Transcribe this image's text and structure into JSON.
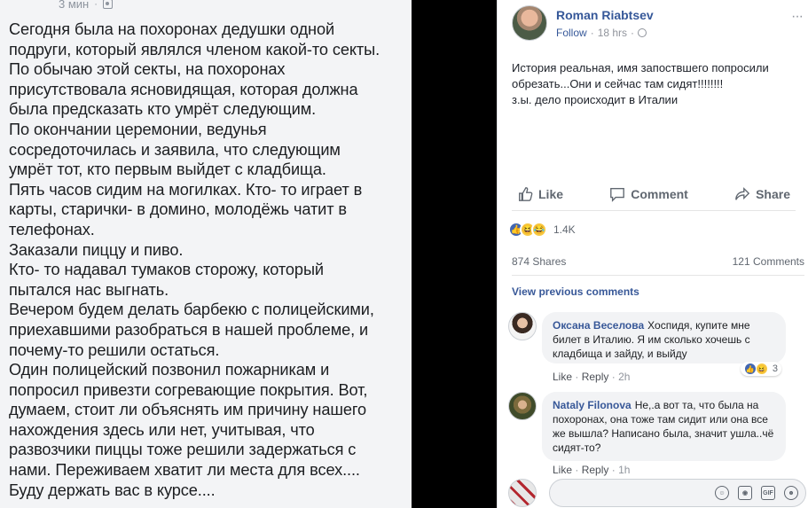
{
  "left_post": {
    "time": "3 мин",
    "dot": "·",
    "paragraphs": [
      "Сегодня была на похоронах дедушки одной\nподруги, который являлся членом какой-то секты.",
      "По обычаю этой секты, на похоронах\nприсутствовала ясновидящая, которая должна\nбыла предсказать кто умрёт следующим.",
      "По окончании церемонии, ведунья\nсосредоточилась и заявила, что следующим\nумрёт тот, кто первым выйдет с кладбища.",
      "Пять часов сидим на могилках. Кто- то играет в\nкарты, старички- в домино, молодёжь чатит в\nтелефонах.",
      "Заказали пиццу и пиво.",
      "Кто- то надавал тумаков сторожу, который\nпытался нас выгнать.",
      "Вечером будем делать барбекю с полицейскими,\nприехавшими разобраться в нашей проблеме, и\nпочему-то решили остаться.",
      "Один полицейский позвонил пожарникам и\nпопросил привезти согревающие покрытия. Вот,\nдумаем, стоит ли объяснять им причину нашего\nнахождения здесь или нет, учитывая, что\nразвозчики пиццы тоже решили задержаться с\nнами. Переживаем хватит ли места для всех....",
      "Буду держать вас в курсе...."
    ]
  },
  "post": {
    "author": "Roman Riabtsev",
    "follow": "Follow",
    "time": "18 hrs",
    "dot": "·",
    "more": "···",
    "text_lines": [
      "История реальная, имя запоствшего попросили",
      "обрезать...Они и сейчас там сидят!!!!!!!!",
      "з.ы. дело происходит в Италии"
    ],
    "actions": {
      "like": "Like",
      "comment": "Comment",
      "share": "Share"
    },
    "reaction_count": "1.4K",
    "shares": "874 Shares",
    "comments_count": "121 Comments",
    "view_previous": "View previous comments"
  },
  "comments": [
    {
      "name": "Оксана Веселова",
      "text": "Хоспидя, купите мне билет в Италию. Я им сколько хочешь с кладбища и зайду, и выйду",
      "like": "Like",
      "reply": "Reply",
      "time": "2h",
      "dot": "·",
      "reactions": "3"
    },
    {
      "name": "Nataly Filonova",
      "text": "Не,.а вот та, что была на похоронах, она тоже там сидит или она все же вышла? Написано была, значит ушла..чё сидят-то?",
      "like": "Like",
      "reply": "Reply",
      "time": "1h",
      "dot": "·"
    }
  ],
  "composer": {
    "icons": [
      "emoji-icon",
      "camera-icon",
      "gif-icon",
      "sticker-icon"
    ],
    "gif_label": "GIF"
  },
  "colors": {
    "link_blue": "#365899",
    "left_bg": "#f3f4f6",
    "dark_band": "#000000"
  }
}
